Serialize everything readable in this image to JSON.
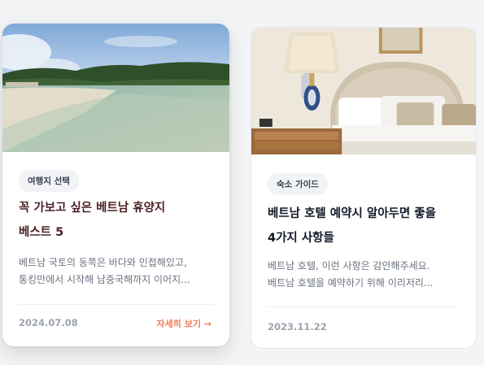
{
  "cards": [
    {
      "tag": "여행지 선택",
      "title_lines": [
        "꼭 가보고 싶은 베트남 휴양지",
        "베스트 5"
      ],
      "excerpt_lines": [
        "베트남 국토의 동쪽은 바다와 인접해있고,",
        "통킹만에서 시작해 남중국해까지 이어지..."
      ],
      "date": "2024.07.08",
      "more_label": "자세히 보기 →"
    },
    {
      "tag": "숙소 가이드",
      "title_lines": [
        "베트남 호텔 예약시 알아두면 좋을",
        "4가지 사항들"
      ],
      "excerpt_lines": [
        "베트남 호텔, 이런 사항은 감안해주세요.",
        "베트남 호텔을 예약하기 위해 이리저리..."
      ],
      "date": "2023.11.22"
    }
  ],
  "colors": {
    "accent": "#f07a5a",
    "title_featured": "#4b1f24",
    "title": "#111827",
    "muted": "#6b7280"
  }
}
